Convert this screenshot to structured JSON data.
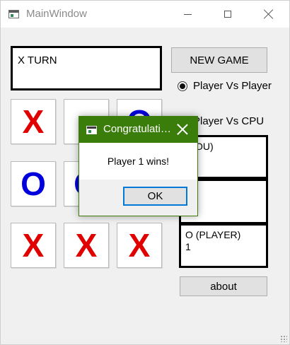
{
  "window": {
    "title": "MainWindow",
    "icons": [
      "app-icon",
      "minimize-icon",
      "maximize-icon",
      "close-icon"
    ]
  },
  "turn": {
    "text": "X TURN"
  },
  "controls": {
    "new_game_label": "NEW GAME",
    "modes": [
      {
        "label": "Player Vs Player",
        "checked": true
      },
      {
        "label": "Player Vs CPU",
        "checked": false
      }
    ],
    "about_label": "about"
  },
  "board": {
    "cells": [
      [
        "X",
        "",
        "O"
      ],
      [
        "O",
        "O",
        ""
      ],
      [
        "X",
        "X",
        "X"
      ]
    ],
    "colors": {
      "X": "#e00000",
      "O": "#0000dd"
    }
  },
  "scores": [
    {
      "label": "(YOU)",
      "value": ""
    },
    {
      "label": "",
      "value": ""
    },
    {
      "label": "O (PLAYER)",
      "value": "1"
    }
  ],
  "dialog": {
    "title": "Congratulations",
    "message": "Player 1 wins!",
    "ok_label": "OK",
    "title_color": "#3b7d0b",
    "focus_color": "#0078d7"
  }
}
